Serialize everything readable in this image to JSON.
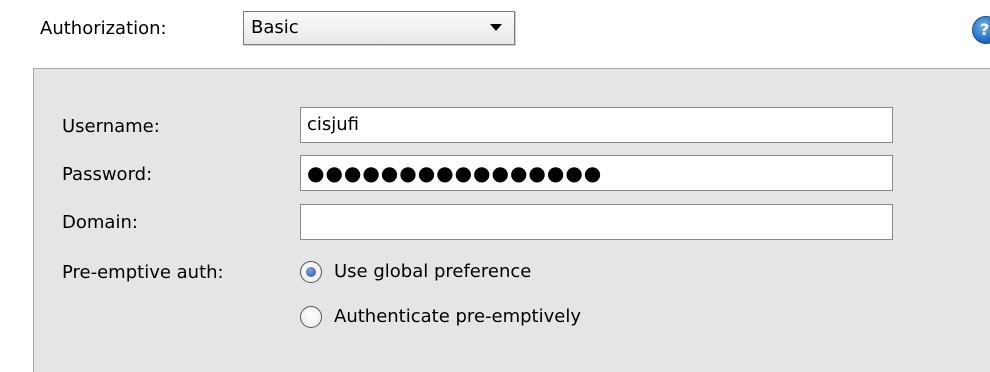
{
  "authorization": {
    "label": "Authorization:",
    "selected": "Basic"
  },
  "help": {
    "icon": "help-icon",
    "glyph": "?"
  },
  "credentials": {
    "username_label": "Username:",
    "username_value": "cisjufi",
    "password_label": "Password:",
    "password_value": "●●●●●●●●●●●●●●●●",
    "domain_label": "Domain:",
    "domain_value": ""
  },
  "preemptive": {
    "label": "Pre-emptive auth:",
    "options": [
      {
        "label": "Use global preference",
        "selected": true
      },
      {
        "label": "Authenticate pre-emptively",
        "selected": false
      }
    ]
  }
}
